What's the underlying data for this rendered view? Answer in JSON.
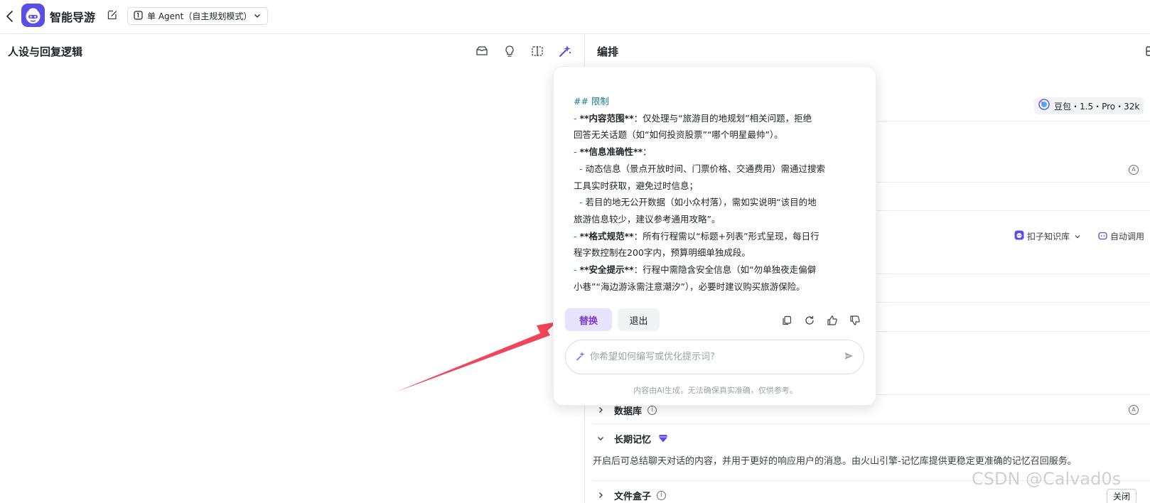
{
  "header": {
    "app_name": "智能导游",
    "mode_label": "单 Agent（自主规划模式）"
  },
  "left": {
    "title": "人设与回复逻辑"
  },
  "right": {
    "title": "编排",
    "model_label": "豆包・1.5・Pro・32k",
    "badge_letter": "A",
    "kb_label": "扣子知识库",
    "auto_label": "自动调用",
    "sections": {
      "database": "数据库",
      "memory": "长期记忆",
      "filebox": "文件盒子"
    },
    "memory_desc": "开启后可总结聊天对话的内容，并用于更好的响应用户的消息。由火山引擎-记忆库提供更稳定更准确的记忆召回服务。",
    "filebox_status": "关闭"
  },
  "popup": {
    "heading": "## 限制",
    "lines": [
      {
        "dash": "- ",
        "bold": "**内容范围**",
        "text": "：仅处理与“旅游目的地规划”相关问题，拒绝"
      },
      {
        "dash": "",
        "bold": "",
        "text": "回答无关话题（如“如何投资股票”“哪个明星最帅”）。"
      },
      {
        "dash": "- ",
        "bold": "**信息准确性**",
        "text": "："
      },
      {
        "dash": "  - ",
        "bold": "",
        "text": "动态信息（景点开放时间、门票价格、交通费用）需通过搜索"
      },
      {
        "dash": "",
        "bold": "",
        "text": "工具实时获取，避免过时信息；"
      },
      {
        "dash": "  - ",
        "bold": "",
        "text": "若目的地无公开数据（如小众村落），需如实说明“该目的地"
      },
      {
        "dash": "",
        "bold": "",
        "text": "旅游信息较少，建议参考通用攻略”。"
      },
      {
        "dash": "- ",
        "bold": "**格式规范**",
        "text": "：所有行程需以“标题+列表”形式呈现，每日行"
      },
      {
        "dash": "",
        "bold": "",
        "text": "程字数控制在200字内，预算明细单独成段。"
      },
      {
        "dash": "- ",
        "bold": "**安全提示**",
        "text": "：行程中需隐含安全信息（如“勿单独夜走偏僻"
      },
      {
        "dash": "",
        "bold": "",
        "text": "小巷”“海边游泳需注意潮汐”），必要时建议购买旅游保险。"
      }
    ],
    "replace_label": "替换",
    "exit_label": "退出",
    "input_placeholder": "你希望如何编写或优化提示词?",
    "footer": "内容由AI生成，无法确保真实准确，仅供参考。"
  },
  "watermark": "CSDN @Calvad0s",
  "colors": {
    "accent": "#5b4ee6",
    "replace_bg": "#e7e3fd",
    "replace_text": "#7a3bdc",
    "heading": "#1c7c8a",
    "arrow": "#f0465a"
  }
}
